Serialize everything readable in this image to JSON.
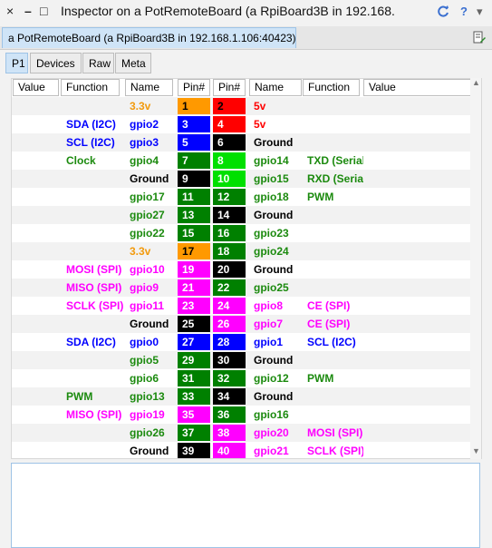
{
  "window": {
    "close_glyph": "×",
    "min_glyph": "–",
    "max_glyph": "□",
    "title": "Inspector on a PotRemoteBoard (a RpiBoard3B in 192.168.",
    "help_glyph": "?",
    "menu_glyph": "▾",
    "refresh_color": "#3a6fd0"
  },
  "object_tab": {
    "label": "a PotRemoteBoard (a RpiBoard3B in 192.168.1.106:40423)"
  },
  "view_tabs": [
    {
      "label": "P1",
      "active": true
    },
    {
      "label": "Devices",
      "active": false
    },
    {
      "label": "Raw",
      "active": false
    },
    {
      "label": "Meta",
      "active": false
    }
  ],
  "columns": [
    "Value",
    "Function",
    "Name",
    "Pin#",
    "Pin#",
    "Name",
    "Function",
    "Value"
  ],
  "colors": {
    "orange": "#ff9900",
    "red": "#ff0000",
    "blue": "#0000ff",
    "black": "#000000",
    "green": "#008000",
    "lime": "#00e000",
    "magenta": "#ff00ff",
    "selection": "#cfe4f7"
  },
  "rows": [
    {
      "lfunc": "",
      "lfc": "c-black",
      "lname": "3.3v",
      "lnc": "c-orange",
      "lpin": "1",
      "lbg": "orange",
      "lpc": "#000",
      "rpin": "2",
      "rbg": "red",
      "rpc": "#000",
      "rname": "5v",
      "rnc": "c-red",
      "rfunc": "",
      "rfc": "c-black"
    },
    {
      "lfunc": "SDA (I2C)",
      "lfc": "c-blue",
      "lname": "gpio2",
      "lnc": "c-blue",
      "lpin": "3",
      "lbg": "blue",
      "lpc": "#fff",
      "rpin": "4",
      "rbg": "red",
      "rpc": "#fff",
      "rname": "5v",
      "rnc": "c-red",
      "rfunc": "",
      "rfc": "c-black"
    },
    {
      "lfunc": "SCL (I2C)",
      "lfc": "c-blue",
      "lname": "gpio3",
      "lnc": "c-blue",
      "lpin": "5",
      "lbg": "blue",
      "lpc": "#fff",
      "rpin": "6",
      "rbg": "black",
      "rpc": "#fff",
      "rname": "Ground",
      "rnc": "c-black",
      "rfunc": "",
      "rfc": "c-black"
    },
    {
      "lfunc": "Clock",
      "lfc": "c-green",
      "lname": "gpio4",
      "lnc": "c-green",
      "lpin": "7",
      "lbg": "green",
      "lpc": "#fff",
      "rpin": "8",
      "rbg": "lime",
      "rpc": "#fff",
      "rname": "gpio14",
      "rnc": "c-green",
      "rfunc": "TXD (Serial",
      "rfc": "c-green"
    },
    {
      "lfunc": "",
      "lfc": "c-black",
      "lname": "Ground",
      "lnc": "c-black",
      "lpin": "9",
      "lbg": "black",
      "lpc": "#fff",
      "rpin": "10",
      "rbg": "lime",
      "rpc": "#fff",
      "rname": "gpio15",
      "rnc": "c-green",
      "rfunc": "RXD (Serial",
      "rfc": "c-green"
    },
    {
      "lfunc": "",
      "lfc": "c-black",
      "lname": "gpio17",
      "lnc": "c-green",
      "lpin": "11",
      "lbg": "green",
      "lpc": "#fff",
      "rpin": "12",
      "rbg": "green",
      "rpc": "#fff",
      "rname": "gpio18",
      "rnc": "c-green",
      "rfunc": "PWM",
      "rfc": "c-green"
    },
    {
      "lfunc": "",
      "lfc": "c-black",
      "lname": "gpio27",
      "lnc": "c-green",
      "lpin": "13",
      "lbg": "green",
      "lpc": "#fff",
      "rpin": "14",
      "rbg": "black",
      "rpc": "#fff",
      "rname": "Ground",
      "rnc": "c-black",
      "rfunc": "",
      "rfc": "c-black"
    },
    {
      "lfunc": "",
      "lfc": "c-black",
      "lname": "gpio22",
      "lnc": "c-green",
      "lpin": "15",
      "lbg": "green",
      "lpc": "#fff",
      "rpin": "16",
      "rbg": "green",
      "rpc": "#fff",
      "rname": "gpio23",
      "rnc": "c-green",
      "rfunc": "",
      "rfc": "c-black"
    },
    {
      "lfunc": "",
      "lfc": "c-black",
      "lname": "3.3v",
      "lnc": "c-orange",
      "lpin": "17",
      "lbg": "orange",
      "lpc": "#000",
      "rpin": "18",
      "rbg": "green",
      "rpc": "#fff",
      "rname": "gpio24",
      "rnc": "c-green",
      "rfunc": "",
      "rfc": "c-black"
    },
    {
      "lfunc": "MOSI (SPI)",
      "lfc": "c-magenta",
      "lname": "gpio10",
      "lnc": "c-magenta",
      "lpin": "19",
      "lbg": "magenta",
      "lpc": "#fff",
      "rpin": "20",
      "rbg": "black",
      "rpc": "#fff",
      "rname": "Ground",
      "rnc": "c-black",
      "rfunc": "",
      "rfc": "c-black"
    },
    {
      "lfunc": "MISO (SPI)",
      "lfc": "c-magenta",
      "lname": "gpio9",
      "lnc": "c-magenta",
      "lpin": "21",
      "lbg": "magenta",
      "lpc": "#fff",
      "rpin": "22",
      "rbg": "green",
      "rpc": "#fff",
      "rname": "gpio25",
      "rnc": "c-green",
      "rfunc": "",
      "rfc": "c-black"
    },
    {
      "lfunc": "SCLK (SPI)",
      "lfc": "c-magenta",
      "lname": "gpio11",
      "lnc": "c-magenta",
      "lpin": "23",
      "lbg": "magenta",
      "lpc": "#fff",
      "rpin": "24",
      "rbg": "magenta",
      "rpc": "#fff",
      "rname": "gpio8",
      "rnc": "c-magenta",
      "rfunc": "CE (SPI)",
      "rfc": "c-magenta"
    },
    {
      "lfunc": "",
      "lfc": "c-black",
      "lname": "Ground",
      "lnc": "c-black",
      "lpin": "25",
      "lbg": "black",
      "lpc": "#fff",
      "rpin": "26",
      "rbg": "magenta",
      "rpc": "#fff",
      "rname": "gpio7",
      "rnc": "c-magenta",
      "rfunc": "CE (SPI)",
      "rfc": "c-magenta"
    },
    {
      "lfunc": "SDA (I2C)",
      "lfc": "c-blue",
      "lname": "gpio0",
      "lnc": "c-blue",
      "lpin": "27",
      "lbg": "blue",
      "lpc": "#fff",
      "rpin": "28",
      "rbg": "blue",
      "rpc": "#fff",
      "rname": "gpio1",
      "rnc": "c-blue",
      "rfunc": "SCL (I2C)",
      "rfc": "c-blue"
    },
    {
      "lfunc": "",
      "lfc": "c-black",
      "lname": "gpio5",
      "lnc": "c-green",
      "lpin": "29",
      "lbg": "green",
      "lpc": "#fff",
      "rpin": "30",
      "rbg": "black",
      "rpc": "#fff",
      "rname": "Ground",
      "rnc": "c-black",
      "rfunc": "",
      "rfc": "c-black"
    },
    {
      "lfunc": "",
      "lfc": "c-black",
      "lname": "gpio6",
      "lnc": "c-green",
      "lpin": "31",
      "lbg": "green",
      "lpc": "#fff",
      "rpin": "32",
      "rbg": "green",
      "rpc": "#fff",
      "rname": "gpio12",
      "rnc": "c-green",
      "rfunc": "PWM",
      "rfc": "c-green"
    },
    {
      "lfunc": "PWM",
      "lfc": "c-green",
      "lname": "gpio13",
      "lnc": "c-green",
      "lpin": "33",
      "lbg": "green",
      "lpc": "#fff",
      "rpin": "34",
      "rbg": "black",
      "rpc": "#fff",
      "rname": "Ground",
      "rnc": "c-black",
      "rfunc": "",
      "rfc": "c-black"
    },
    {
      "lfunc": "MISO (SPI)",
      "lfc": "c-magenta",
      "lname": "gpio19",
      "lnc": "c-magenta",
      "lpin": "35",
      "lbg": "magenta",
      "lpc": "#fff",
      "rpin": "36",
      "rbg": "green",
      "rpc": "#fff",
      "rname": "gpio16",
      "rnc": "c-green",
      "rfunc": "",
      "rfc": "c-black"
    },
    {
      "lfunc": "",
      "lfc": "c-black",
      "lname": "gpio26",
      "lnc": "c-green",
      "lpin": "37",
      "lbg": "green",
      "lpc": "#fff",
      "rpin": "38",
      "rbg": "magenta",
      "rpc": "#fff",
      "rname": "gpio20",
      "rnc": "c-magenta",
      "rfunc": "MOSI (SPI)",
      "rfc": "c-magenta"
    },
    {
      "lfunc": "",
      "lfc": "c-black",
      "lname": "Ground",
      "lnc": "c-black",
      "lpin": "39",
      "lbg": "black",
      "lpc": "#fff",
      "rpin": "40",
      "rbg": "magenta",
      "rpc": "#fff",
      "rname": "gpio21",
      "rnc": "c-magenta",
      "rfunc": "SCLK (SPI)",
      "rfc": "c-magenta"
    }
  ],
  "editor": {
    "text": ""
  }
}
